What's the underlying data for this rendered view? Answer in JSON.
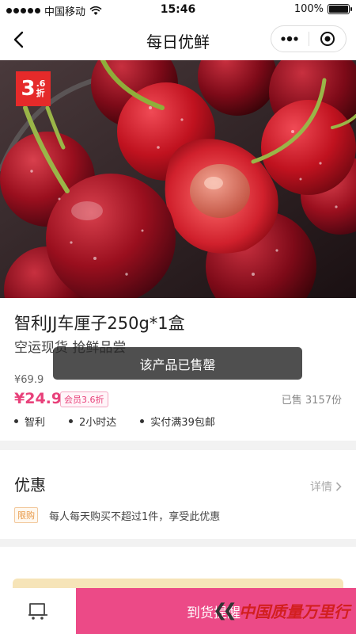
{
  "status_bar": {
    "carrier": "中国移动",
    "time": "15:46",
    "battery": "100%"
  },
  "nav": {
    "title": "每日优鲜"
  },
  "hero": {
    "discount_big": "3",
    "discount_small_top": ".6",
    "discount_small_bottom": "折",
    "colors": {
      "tag": "#e52a2a"
    }
  },
  "product": {
    "title": "智利JJ车厘子250g*1盒",
    "subtitle": "空运现货 抢鲜品尝",
    "original_price": "¥69.9",
    "current_price": "¥24.9",
    "member_badge": "会员3.6折",
    "sold_label": "已售  3157份",
    "features": [
      "智利",
      "2小时达",
      "实付满39包邮"
    ]
  },
  "toast": {
    "message": "该产品已售罄"
  },
  "offers": {
    "title": "优惠",
    "details_label": "详情",
    "limit_tag": "限购",
    "limit_text": "每人每天购买不超过1件，享受此优惠"
  },
  "bottom_bar": {
    "notify_label": "到货提醒",
    "watermark": "中国质量万里行"
  },
  "colors": {
    "accent": "#ec4a87",
    "price": "#e8417a"
  }
}
